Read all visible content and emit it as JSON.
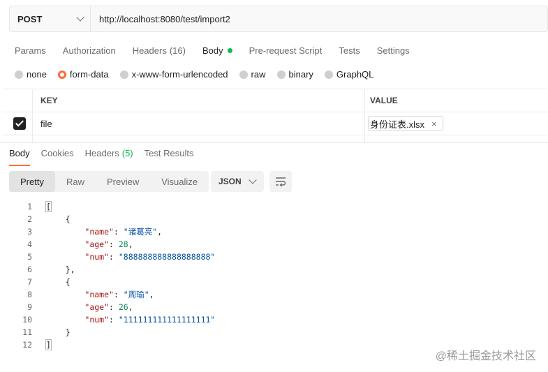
{
  "request": {
    "method": "POST",
    "url": "http://localhost:8080/test/import2"
  },
  "request_tabs": [
    {
      "label": "Params"
    },
    {
      "label": "Authorization"
    },
    {
      "label": "Headers",
      "count": "(16)"
    },
    {
      "label": "Body",
      "active": true
    },
    {
      "label": "Pre-request Script"
    },
    {
      "label": "Tests"
    },
    {
      "label": "Settings"
    }
  ],
  "body_types": [
    {
      "label": "none"
    },
    {
      "label": "form-data",
      "selected": true
    },
    {
      "label": "x-www-form-urlencoded"
    },
    {
      "label": "raw"
    },
    {
      "label": "binary"
    },
    {
      "label": "GraphQL"
    }
  ],
  "kv_table": {
    "key_header": "KEY",
    "value_header": "VALUE",
    "rows": [
      {
        "checked": true,
        "key": "file",
        "value": "身份证表.xlsx",
        "remove_glyph": "×"
      }
    ]
  },
  "response_tabs": [
    {
      "label": "Body",
      "active": true
    },
    {
      "label": "Cookies"
    },
    {
      "label": "Headers",
      "count": "(5)"
    },
    {
      "label": "Test Results"
    }
  ],
  "view_modes": [
    "Pretty",
    "Raw",
    "Preview",
    "Visualize"
  ],
  "active_view": "Pretty",
  "format": "JSON",
  "line_numbers": [
    "1",
    "2",
    "3",
    "4",
    "5",
    "6",
    "7",
    "8",
    "9",
    "10",
    "11",
    "12"
  ],
  "response_json": [
    {
      "name": "\"诸葛亮\"",
      "age": "28",
      "num": "\"888888888888888888\""
    },
    {
      "name": "\"周瑜\"",
      "age": "26",
      "num": "\"111111111111111111\""
    }
  ],
  "json_keys": {
    "name": "\"name\"",
    "age": "\"age\"",
    "num": "\"num\""
  },
  "watermark": "@稀土掘金技术社区",
  "colors": {
    "accent": "#ff6c37",
    "success": "#0cbb52",
    "json_key": "#a31515",
    "json_string": "#0451a5",
    "json_number": "#098658"
  }
}
